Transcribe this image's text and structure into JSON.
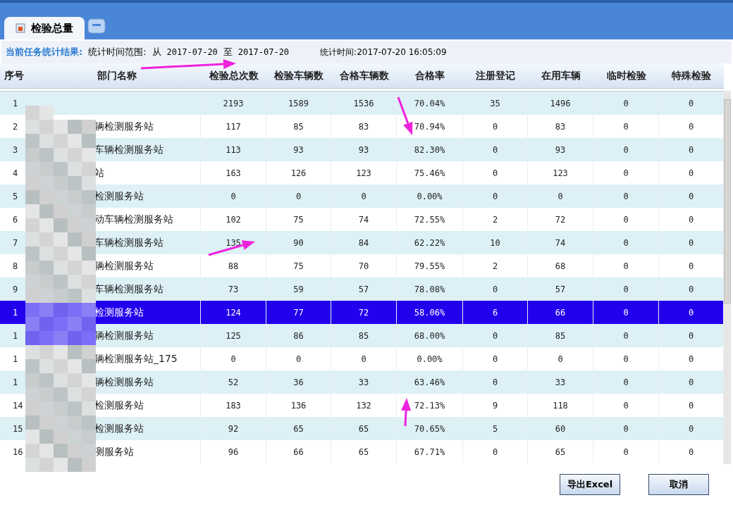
{
  "tab": {
    "label": "检验总量",
    "selected": true
  },
  "info": {
    "title": "当前任务统计结果:",
    "range_label": "统计时间范围:",
    "from_word": "从",
    "from": "2017-07-20",
    "to_word": "至",
    "to": "2017-07-20",
    "stat_time": "统计时间:2017-07-20 16:05:09"
  },
  "table": {
    "columns": [
      "序号",
      "部门名称",
      "检验总次数",
      "检验车辆数",
      "合格车辆数",
      "合格率",
      "注册登记",
      "在用车辆",
      "临时检验",
      "特殊检验"
    ],
    "rows": [
      {
        "seq": "1",
        "name": "",
        "values": [
          "2193",
          "1589",
          "1536",
          "70.04%",
          "35",
          "1496",
          "0",
          "0"
        ],
        "selected": false
      },
      {
        "seq": "2",
        "name": "辆检测服务站",
        "values": [
          "117",
          "85",
          "83",
          "70.94%",
          "0",
          "83",
          "0",
          "0"
        ],
        "selected": false
      },
      {
        "seq": "3",
        "name": "车辆检测服务站",
        "values": [
          "113",
          "93",
          "93",
          "82.30%",
          "0",
          "93",
          "0",
          "0"
        ],
        "selected": false
      },
      {
        "seq": "4",
        "name": "站",
        "values": [
          "163",
          "126",
          "123",
          "75.46%",
          "0",
          "123",
          "0",
          "0"
        ],
        "selected": false
      },
      {
        "seq": "5",
        "name": "检测服务站",
        "values": [
          "0",
          "0",
          "0",
          "0.00%",
          "0",
          "0",
          "0",
          "0"
        ],
        "selected": false
      },
      {
        "seq": "6",
        "name": "动车辆检测服务站",
        "values": [
          "102",
          "75",
          "74",
          "72.55%",
          "2",
          "72",
          "0",
          "0"
        ],
        "selected": false
      },
      {
        "seq": "7",
        "name": "车辆检测服务站",
        "values": [
          "135",
          "90",
          "84",
          "62.22%",
          "10",
          "74",
          "0",
          "0"
        ],
        "selected": false
      },
      {
        "seq": "8",
        "name": "辆检测服务站",
        "values": [
          "88",
          "75",
          "70",
          "79.55%",
          "2",
          "68",
          "0",
          "0"
        ],
        "selected": false
      },
      {
        "seq": "9",
        "name": "车辆检测服务站",
        "values": [
          "73",
          "59",
          "57",
          "78.08%",
          "0",
          "57",
          "0",
          "0"
        ],
        "selected": false
      },
      {
        "seq": "1",
        "name": "检测服务站",
        "values": [
          "124",
          "77",
          "72",
          "58.06%",
          "6",
          "66",
          "0",
          "0"
        ],
        "selected": true
      },
      {
        "seq": "1",
        "name": "辆检测服务站",
        "values": [
          "125",
          "86",
          "85",
          "68.00%",
          "0",
          "85",
          "0",
          "0"
        ],
        "selected": false
      },
      {
        "seq": "1",
        "name": "辆检测服务站_175",
        "values": [
          "0",
          "0",
          "0",
          "0.00%",
          "0",
          "0",
          "0",
          "0"
        ],
        "selected": false
      },
      {
        "seq": "1",
        "name": "辆检测服务站",
        "values": [
          "52",
          "36",
          "33",
          "63.46%",
          "0",
          "33",
          "0",
          "0"
        ],
        "selected": false
      },
      {
        "seq": "14",
        "name": "检测服务站",
        "values": [
          "183",
          "136",
          "132",
          "72.13%",
          "9",
          "118",
          "0",
          "0"
        ],
        "selected": false
      },
      {
        "seq": "15",
        "name": "检测服务站",
        "values": [
          "92",
          "65",
          "65",
          "70.65%",
          "5",
          "60",
          "0",
          "0"
        ],
        "selected": false
      },
      {
        "seq": "16",
        "name": "测服务站",
        "values": [
          "96",
          "66",
          "65",
          "67.71%",
          "0",
          "65",
          "0",
          "0"
        ],
        "selected": false
      }
    ]
  },
  "buttons": [
    "导出Excel",
    "取消"
  ]
}
